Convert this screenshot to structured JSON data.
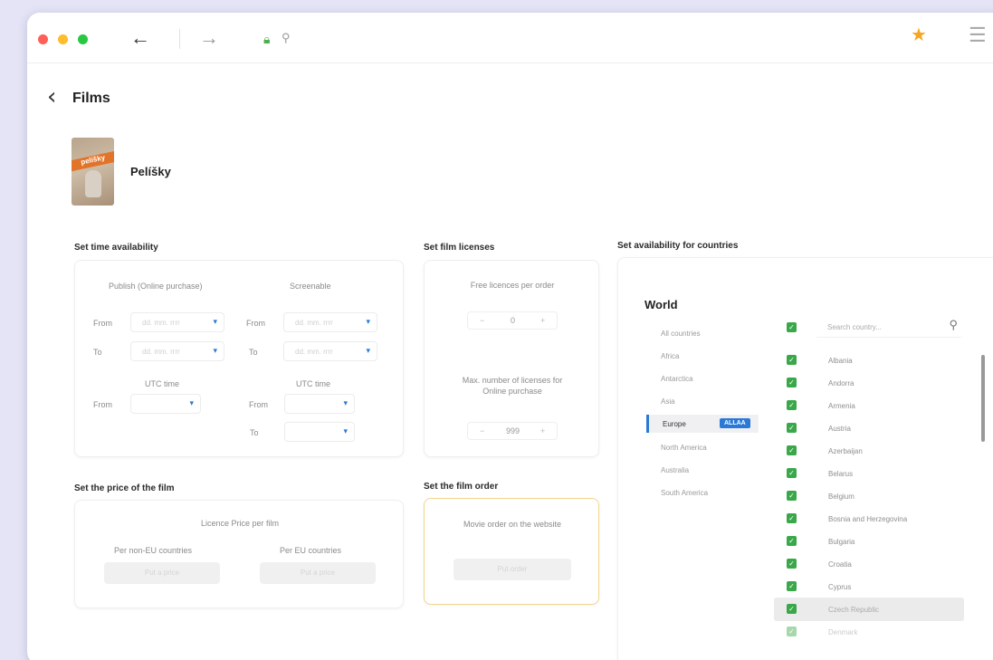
{
  "header": {
    "title": "Films"
  },
  "film": {
    "title": "Pelíšky",
    "poster_text": "pelíšky"
  },
  "icons": {
    "lock": "lock-icon",
    "search": "search-icon",
    "star": "star-icon",
    "menu": "hamburger-icon",
    "back": "back-arrow-icon",
    "forward": "forward-arrow-icon"
  },
  "colors": {
    "accent": "#2a7ad5",
    "check": "#3aa84a",
    "star": "#f5a623",
    "order_border": "#f3d68d"
  },
  "time": {
    "title": "Set time availability",
    "publish_label": "Publish (Online purchase)",
    "screenable_label": "Screenable",
    "from": "From",
    "to": "To",
    "date_ph": "dd. mm. rrrr",
    "utc_label": "UTC time"
  },
  "licenses": {
    "title": "Set film licenses",
    "free_label": "Free licences per order",
    "free_value": "0",
    "max_label": "Max. number of licenses for Online purchase",
    "max_value": "999",
    "minus": "−",
    "plus": "+"
  },
  "price": {
    "title": "Set the price of the film",
    "licence_label": "Licence Price per film",
    "non_eu_label": "Per non-EU countries",
    "eu_label": "Per EU countries",
    "non_eu_btn": "Put a price",
    "eu_btn": "Put a price"
  },
  "order": {
    "title": "Set the film order",
    "movie_label": "Movie order on the website",
    "btn": "Put order"
  },
  "countries": {
    "title": "Set availability for countries",
    "world": "World",
    "search_ph": "Search country...",
    "regions": [
      "All countries",
      "Africa",
      "Antarctica",
      "Asia",
      "Europe",
      "North America",
      "Australia",
      "South America"
    ],
    "selected_region": "Europe",
    "selected_tag": "ALLAA",
    "list": [
      "Albania",
      "Andorra",
      "Armenia",
      "Austria",
      "Azerbaijan",
      "Belarus",
      "Belgium",
      "Bosnia and Herzegovina",
      "Bulgaria",
      "Croatia",
      "Cyprus",
      "Czech Republic",
      "Denmark"
    ]
  }
}
